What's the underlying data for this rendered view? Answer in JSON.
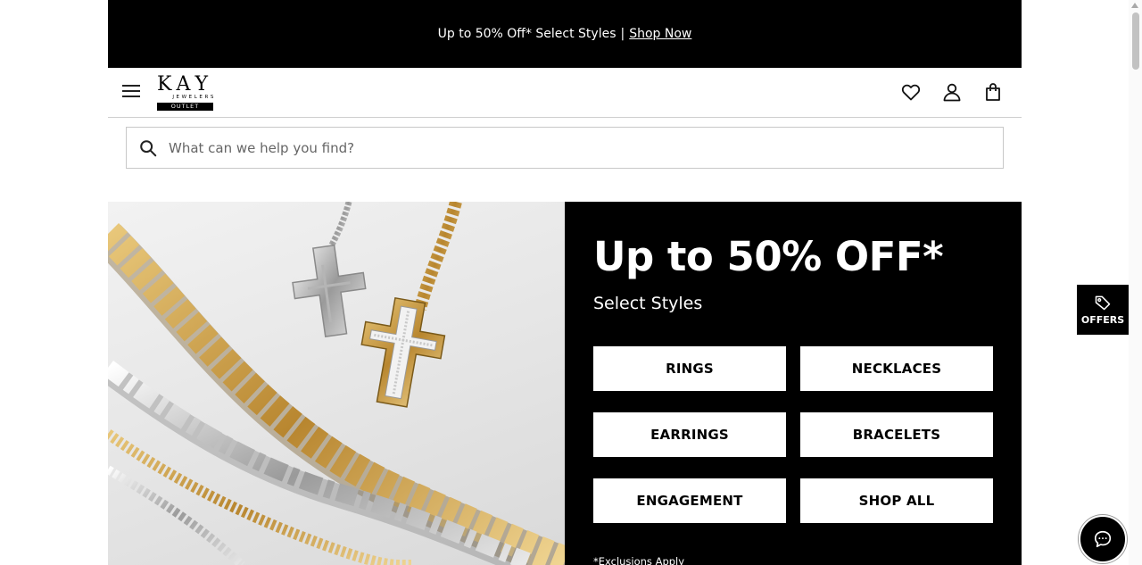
{
  "promo": {
    "text": "Up to 50% Off* Select Styles",
    "separator": "|",
    "link_label": "Shop Now"
  },
  "header": {
    "logo": {
      "brand": "KAY",
      "sub": "JEWELERS",
      "badge": "OUTLET"
    },
    "icons": [
      "menu-icon",
      "heart-icon",
      "user-icon",
      "bag-icon"
    ]
  },
  "search": {
    "placeholder": "What can we help you find?",
    "value": ""
  },
  "hero": {
    "headline": "Up to 50% OFF*",
    "subheadline": "Select Styles",
    "categories": [
      {
        "label": "RINGS"
      },
      {
        "label": "NECKLACES"
      },
      {
        "label": "EARRINGS"
      },
      {
        "label": "BRACELETS"
      },
      {
        "label": "ENGAGEMENT"
      },
      {
        "label": "SHOP ALL"
      }
    ],
    "disclaimer": "*Exclusions Apply"
  },
  "offers_tab": {
    "label": "OFFERS"
  },
  "colors": {
    "promo_bg": "#000000",
    "panel_bg": "#000000",
    "button_bg": "#ffffff",
    "gold": "#c9a24a",
    "silver": "#cfcfcf"
  }
}
